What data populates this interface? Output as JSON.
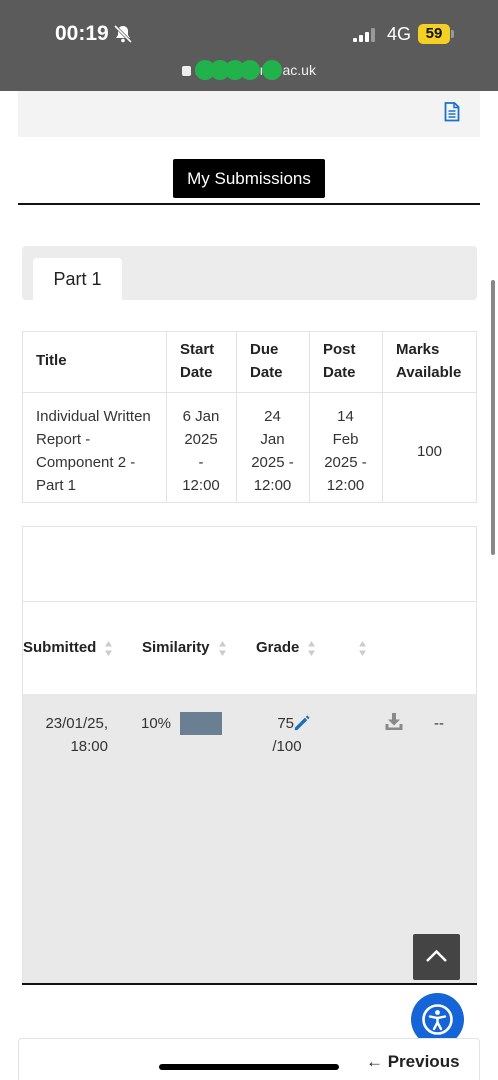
{
  "status_bar": {
    "time": "00:19",
    "network": "4G",
    "battery": "59",
    "url_prefix": "r",
    "url_mid": "ri",
    "url_suffix": "ac.uk"
  },
  "header": {
    "my_submissions_label": "My Submissions"
  },
  "tabs": [
    {
      "label": "Part 1"
    }
  ],
  "details_table": {
    "headers": {
      "title": "Title",
      "start_1": "Start",
      "start_2": "Date",
      "due_1": "Due",
      "due_2": "Date",
      "post_1": "Post",
      "post_2": "Date",
      "marks_1": "Marks",
      "marks_2": "Available"
    },
    "row": {
      "title_lines": [
        "Individual Written",
        "Report -",
        "Component 2 -",
        "Part 1"
      ],
      "start_lines": [
        "6 Jan",
        "2025",
        "-",
        "12:00"
      ],
      "due_lines": [
        "24",
        "Jan",
        "2025 -",
        "12:00"
      ],
      "post_lines": [
        "14",
        "Feb",
        "2025 -",
        "12:00"
      ],
      "marks": "100"
    }
  },
  "submissions_table": {
    "headers": {
      "submitted": "Submitted",
      "similarity": "Similarity",
      "grade": "Grade"
    },
    "row": {
      "submitted_line1": "23/01/25,",
      "submitted_line2": "18:00",
      "similarity": "10%",
      "grade_value": "75",
      "grade_total": "/100",
      "last": "--"
    }
  },
  "footer": {
    "previous_label": "← Previous"
  },
  "colors": {
    "status_bar": "#5b5b5b",
    "battery": "#f4d023",
    "accent_blue": "#1565d8",
    "similarity_bar": "#6b7f93"
  },
  "icons": [
    "bell-muted-icon",
    "signal-icon",
    "lock-icon",
    "document-icon",
    "sort-icon",
    "pencil-icon",
    "download-icon",
    "chevron-up-icon",
    "accessibility-icon"
  ]
}
